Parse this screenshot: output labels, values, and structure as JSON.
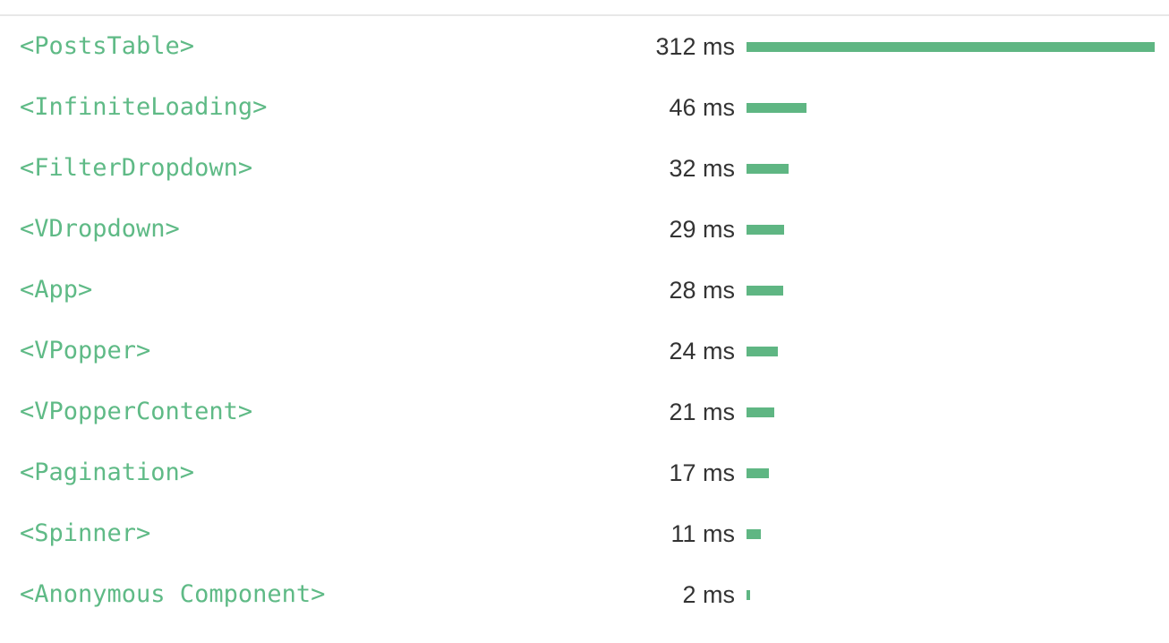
{
  "colors": {
    "component_name": "#5fba86",
    "bar": "#5fb683",
    "time_text": "#333333"
  },
  "max_time_ms": 312,
  "components": [
    {
      "name": "<PostsTable>",
      "time_label": "312 ms",
      "time_ms": 312
    },
    {
      "name": "<InfiniteLoading>",
      "time_label": "46 ms",
      "time_ms": 46
    },
    {
      "name": "<FilterDropdown>",
      "time_label": "32 ms",
      "time_ms": 32
    },
    {
      "name": "<VDropdown>",
      "time_label": "29 ms",
      "time_ms": 29
    },
    {
      "name": "<App>",
      "time_label": "28 ms",
      "time_ms": 28
    },
    {
      "name": "<VPopper>",
      "time_label": "24 ms",
      "time_ms": 24
    },
    {
      "name": "<VPopperContent>",
      "time_label": "21 ms",
      "time_ms": 21
    },
    {
      "name": "<Pagination>",
      "time_label": "17 ms",
      "time_ms": 17
    },
    {
      "name": "<Spinner>",
      "time_label": "11 ms",
      "time_ms": 11
    },
    {
      "name": "<Anonymous Component>",
      "time_label": "2 ms",
      "time_ms": 2
    }
  ]
}
